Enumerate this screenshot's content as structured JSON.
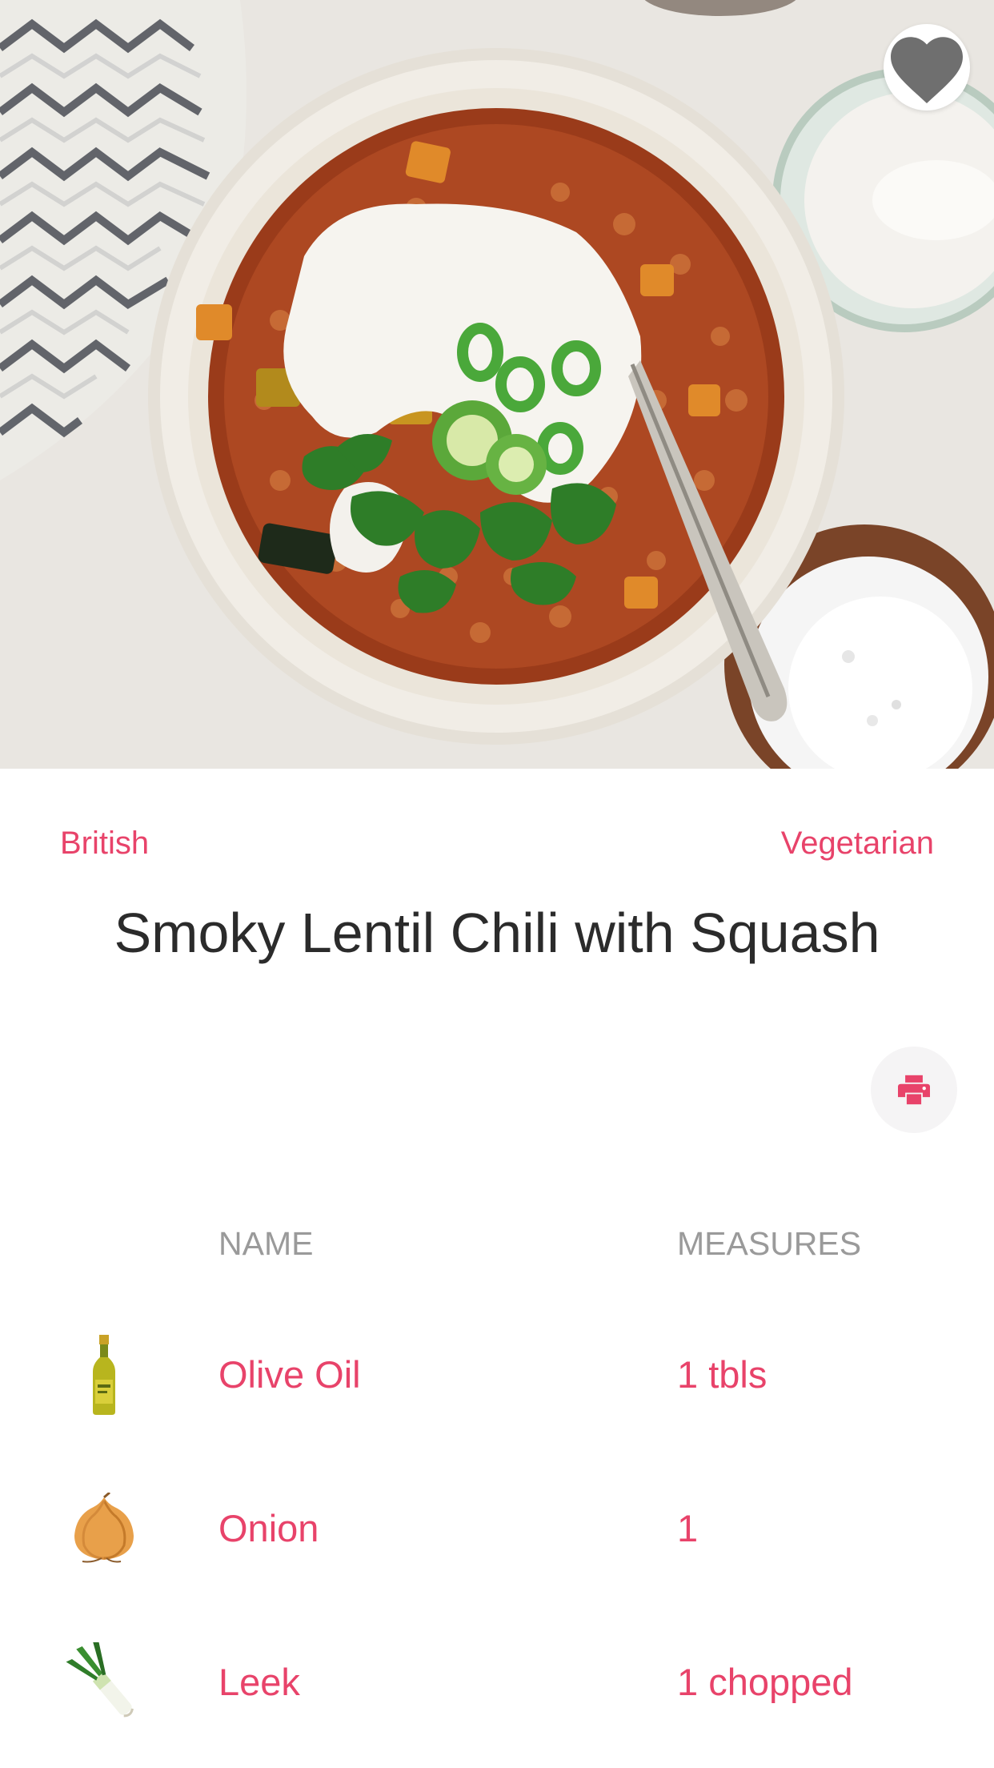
{
  "recipe": {
    "category": "British",
    "area": "Vegetarian",
    "title": "Smoky Lentil Chili with Squash"
  },
  "icons": {
    "favorite": "heart-icon",
    "print": "printer-icon"
  },
  "colors": {
    "accent": "#e8436a",
    "title": "#2b2b2b",
    "header": "#9a9a9a"
  },
  "ingredients": {
    "headers": {
      "name": "NAME",
      "measures": "MEASURES"
    },
    "items": [
      {
        "name": "Olive Oil",
        "measure": "1 tbls",
        "icon": "olive-oil-bottle-icon"
      },
      {
        "name": "Onion",
        "measure": "1",
        "icon": "onion-icon"
      },
      {
        "name": "Leek",
        "measure": "1 chopped",
        "icon": "leek-icon"
      }
    ]
  }
}
